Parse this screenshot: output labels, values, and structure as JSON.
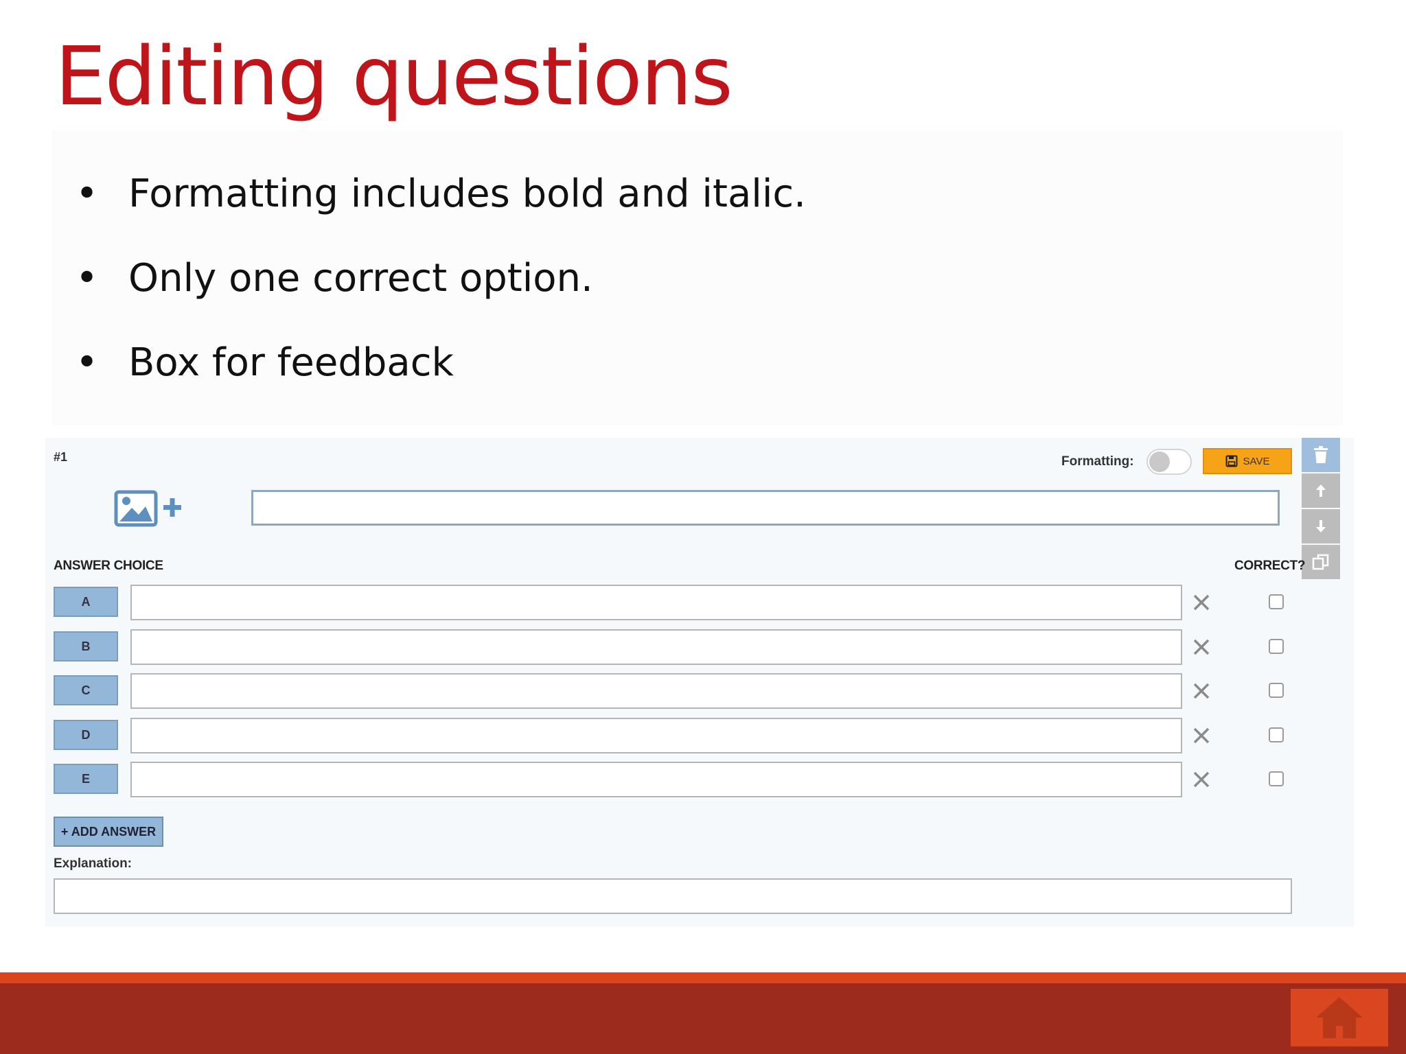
{
  "slide": {
    "title": "Editing questions",
    "bullets": [
      {
        "symbol": "•",
        "text": "Formatting includes bold and italic."
      },
      {
        "symbol": "•",
        "text": "Only one correct option."
      },
      {
        "symbol": "•",
        "text": "Box for feedback"
      }
    ]
  },
  "editor": {
    "question_number": "#1",
    "formatting_label": "Formatting:",
    "formatting_enabled": false,
    "save_label": "SAVE",
    "question_text": "",
    "answer_choice_header": "ANSWER CHOICE",
    "correct_header": "CORRECT?",
    "answers": [
      {
        "letter": "A",
        "text": "",
        "correct": false
      },
      {
        "letter": "B",
        "text": "",
        "correct": false
      },
      {
        "letter": "C",
        "text": "",
        "correct": false
      },
      {
        "letter": "D",
        "text": "",
        "correct": false
      },
      {
        "letter": "E",
        "text": "",
        "correct": false
      }
    ],
    "add_answer_label": "+ ADD ANSWER",
    "explanation_label": "Explanation:",
    "explanation_text": "",
    "side_tools": [
      "trash-icon",
      "arrow-up-icon",
      "arrow-down-icon",
      "duplicate-icon"
    ]
  },
  "colors": {
    "title": "#c0141b",
    "save_button": "#f7a318",
    "letter_tile": "#93b7d8",
    "footer": "#9c2b1e",
    "footer_accent": "#d9461f"
  }
}
